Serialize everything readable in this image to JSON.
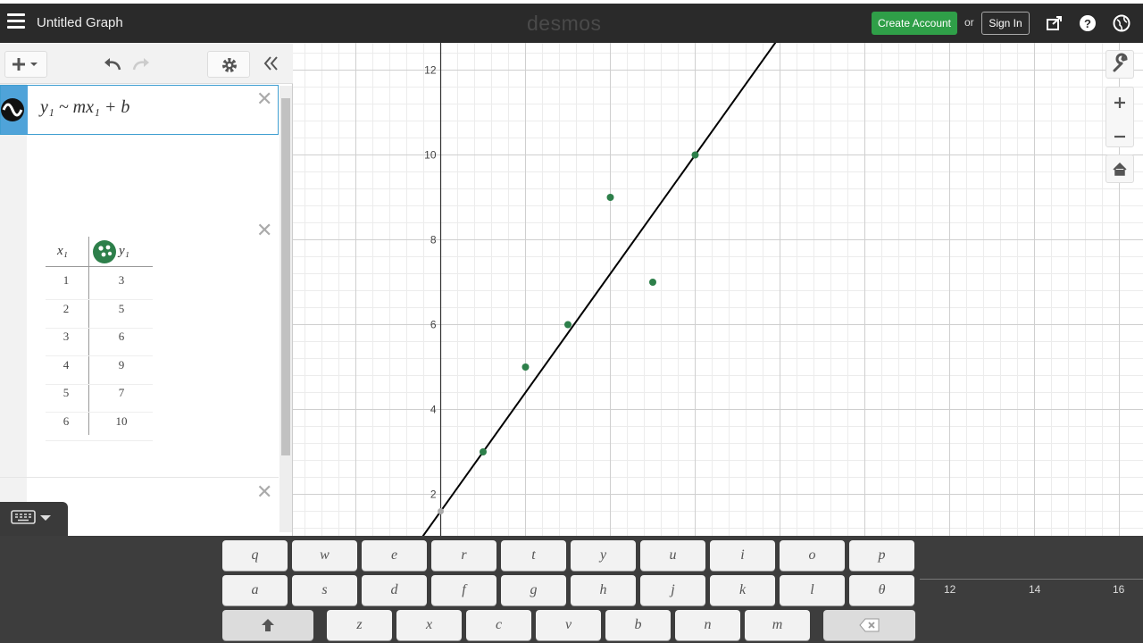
{
  "header": {
    "title": "Untitled Graph",
    "logo": "desmos",
    "create_account": "Create Account",
    "or": "or",
    "sign_in": "Sign In",
    "icons": [
      "share-icon",
      "help-icon",
      "globe-icon"
    ]
  },
  "expression": {
    "formula": "y₁ ~ mx₁ + b"
  },
  "table": {
    "x_header": "x₁",
    "y_header": "y₁",
    "rows": [
      {
        "x": "1",
        "y": "3"
      },
      {
        "x": "2",
        "y": "5"
      },
      {
        "x": "3",
        "y": "6"
      },
      {
        "x": "4",
        "y": "9"
      },
      {
        "x": "5",
        "y": "7"
      },
      {
        "x": "6",
        "y": "10"
      }
    ]
  },
  "graph": {
    "y_ticks": [
      "2",
      "4",
      "6",
      "8",
      "10",
      "12"
    ],
    "x_ticks": [
      "12",
      "14",
      "16"
    ],
    "point_color": "#2d7f4a",
    "line_color": "#000000"
  },
  "keyboard": {
    "row1": [
      "q",
      "w",
      "e",
      "r",
      "t",
      "y",
      "u",
      "i",
      "o",
      "p"
    ],
    "row2": [
      "a",
      "s",
      "d",
      "f",
      "g",
      "h",
      "j",
      "k",
      "l",
      "θ"
    ],
    "row3": [
      "z",
      "x",
      "c",
      "v",
      "b",
      "n",
      "m"
    ]
  },
  "colors": {
    "header_bg": "#2a2a2a",
    "accent_green": "#2f9f48",
    "expr_blue": "#4fa3d9"
  }
}
